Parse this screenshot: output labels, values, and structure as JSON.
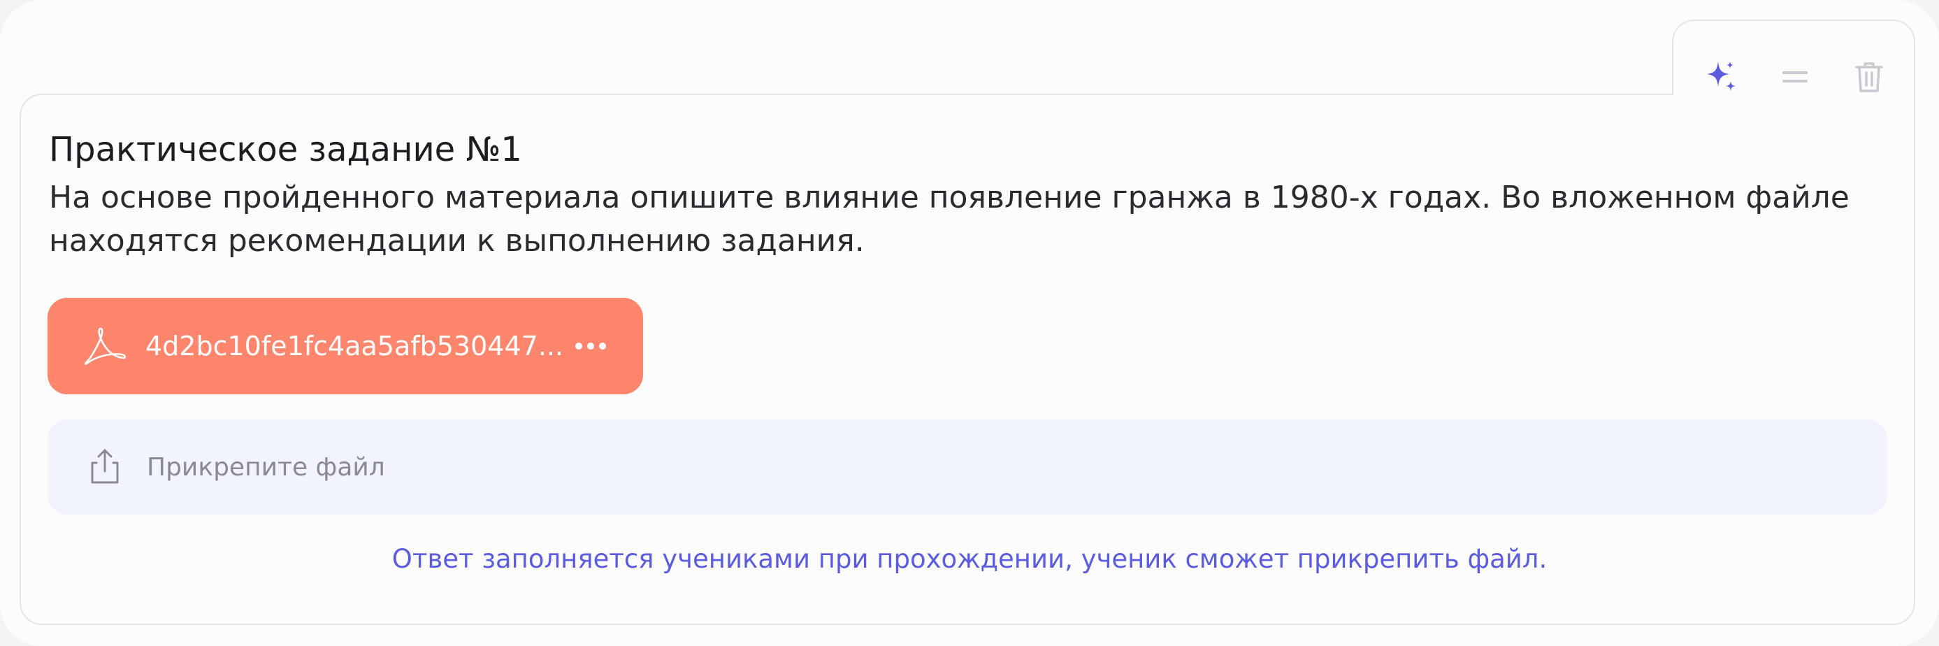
{
  "toolbar": {
    "sparkle_icon": "sparkle-icon",
    "drag_icon": "drag-handle-icon",
    "trash_icon": "trash-icon"
  },
  "task": {
    "title": "Практическое задание №1",
    "description": "На основе пройденного материала опишите влияние появление гранжа в 1980-х годах. Во вложенном файле находятся рекомендации к выполнению задания."
  },
  "attachment": {
    "file_name": "4d2bc10fe1fc4aa5afb530447...",
    "icon": "pdf-icon",
    "more_icon": "more-horizontal-icon"
  },
  "upload": {
    "label": "Прикрепите файл",
    "icon": "upload-icon"
  },
  "hint": "Ответ заполняется учениками при прохождении, ученик сможет прикрепить файл.",
  "colors": {
    "accent": "#5b5ce0",
    "attachment_bg": "#ff866d",
    "dropzone_bg": "#f1f3fd",
    "border": "#e4e4ea"
  }
}
